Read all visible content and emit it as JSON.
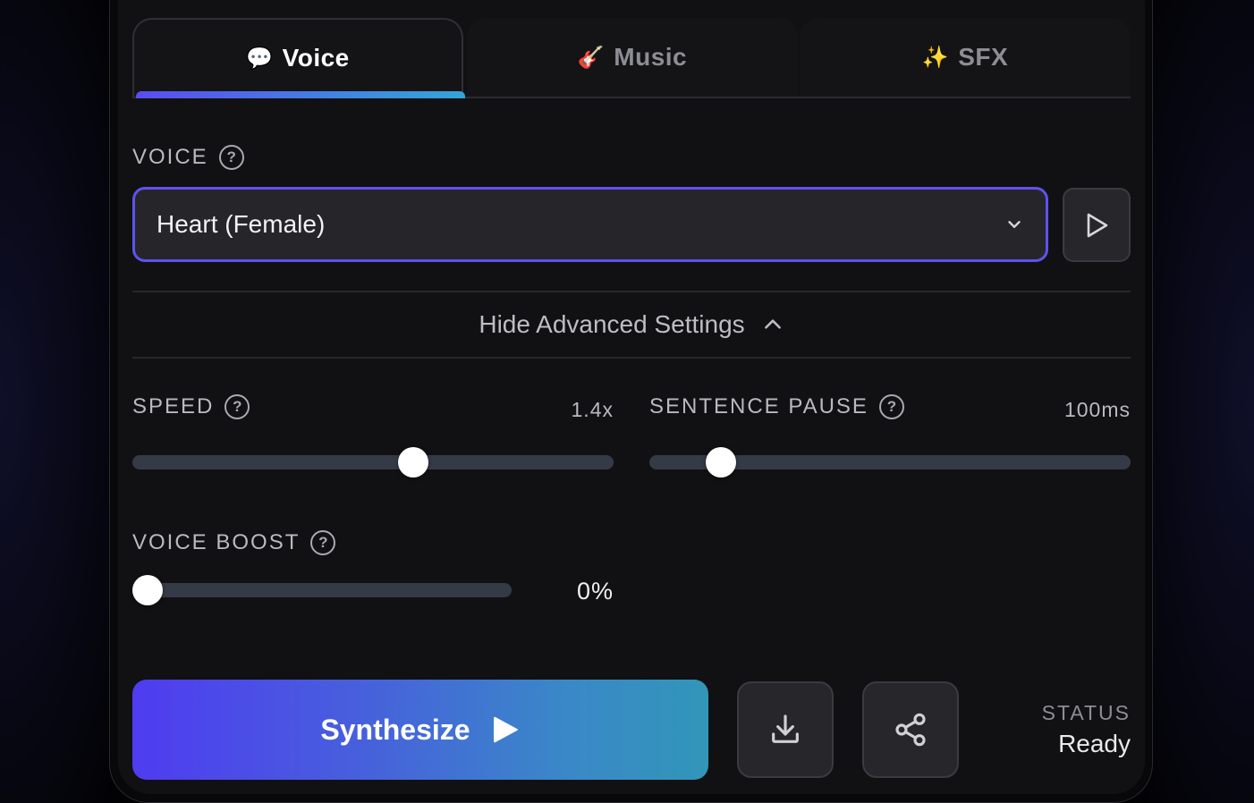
{
  "tabs": [
    {
      "emoji": "💬",
      "label": "Voice",
      "active": true
    },
    {
      "emoji": "🎸",
      "label": "Music",
      "active": false
    },
    {
      "emoji": "✨",
      "label": "SFX",
      "active": false
    }
  ],
  "voice": {
    "label": "VOICE",
    "selected": "Heart (Female)",
    "help_icon": "question-circle-icon",
    "preview_icon": "play-outline-icon"
  },
  "advanced": {
    "toggle_label": "Hide Advanced Settings",
    "toggle_icon": "chevron-up-icon"
  },
  "speed": {
    "label": "SPEED",
    "value": "1.4x",
    "position_fraction": 0.59
  },
  "sentence_pause": {
    "label": "SENTENCE PAUSE",
    "value": "100ms",
    "position_fraction": 0.125
  },
  "voice_boost": {
    "label": "VOICE BOOST",
    "value": "0%",
    "position_fraction": 0.0
  },
  "actions": {
    "synthesize_label": "Synthesize",
    "download_icon": "download-icon",
    "share_icon": "share-icon"
  },
  "status": {
    "label": "STATUS",
    "value": "Ready"
  },
  "colors": {
    "accent": "#5f52ee",
    "gradient_start": "#4f3cf0",
    "gradient_end": "#3196b8"
  }
}
